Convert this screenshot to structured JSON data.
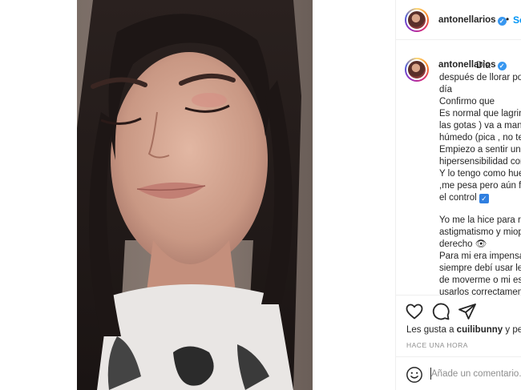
{
  "post": {
    "username": "antonellarios",
    "follow_label": "Se",
    "separator": "•"
  },
  "caption": {
    "username": "antonellarios",
    "lines": [
      "Día",
      "después de llorar po",
      "día",
      "Confirmo que",
      "Es normal que lagrin",
      "las gotas ) va a mant",
      "húmedo (pica , no te",
      "Empiezo a sentir un",
      "hipersensibilidad cor",
      "Y lo tengo como hue",
      ",me pesa pero aún fa",
      "el control",
      "",
      "Yo me la hice para re",
      "astigmatismo y miop",
      "derecho 👁",
      "Para mi era impensa",
      "siempre debí usar le",
      "de moverme o mi es",
      "usarlos correctamen"
    ],
    "check_mark": "✓"
  },
  "actions": {
    "likes_prefix": "Les gusta a",
    "likes_user": "cuilibunny",
    "likes_suffix": "y per",
    "time_ago": "HACE UNA HORA"
  },
  "comment": {
    "placeholder": "Añade un comentario..."
  },
  "icons": {
    "like": "heart-icon",
    "comment": "comment-icon",
    "share": "paper-plane-icon",
    "emoji": "smiley-icon",
    "verified": "verified-badge-icon"
  },
  "colors": {
    "accent": "#0095f6",
    "verified": "#3897f0",
    "text": "#262626",
    "muted": "#8e8e8e",
    "border": "#efefef"
  }
}
